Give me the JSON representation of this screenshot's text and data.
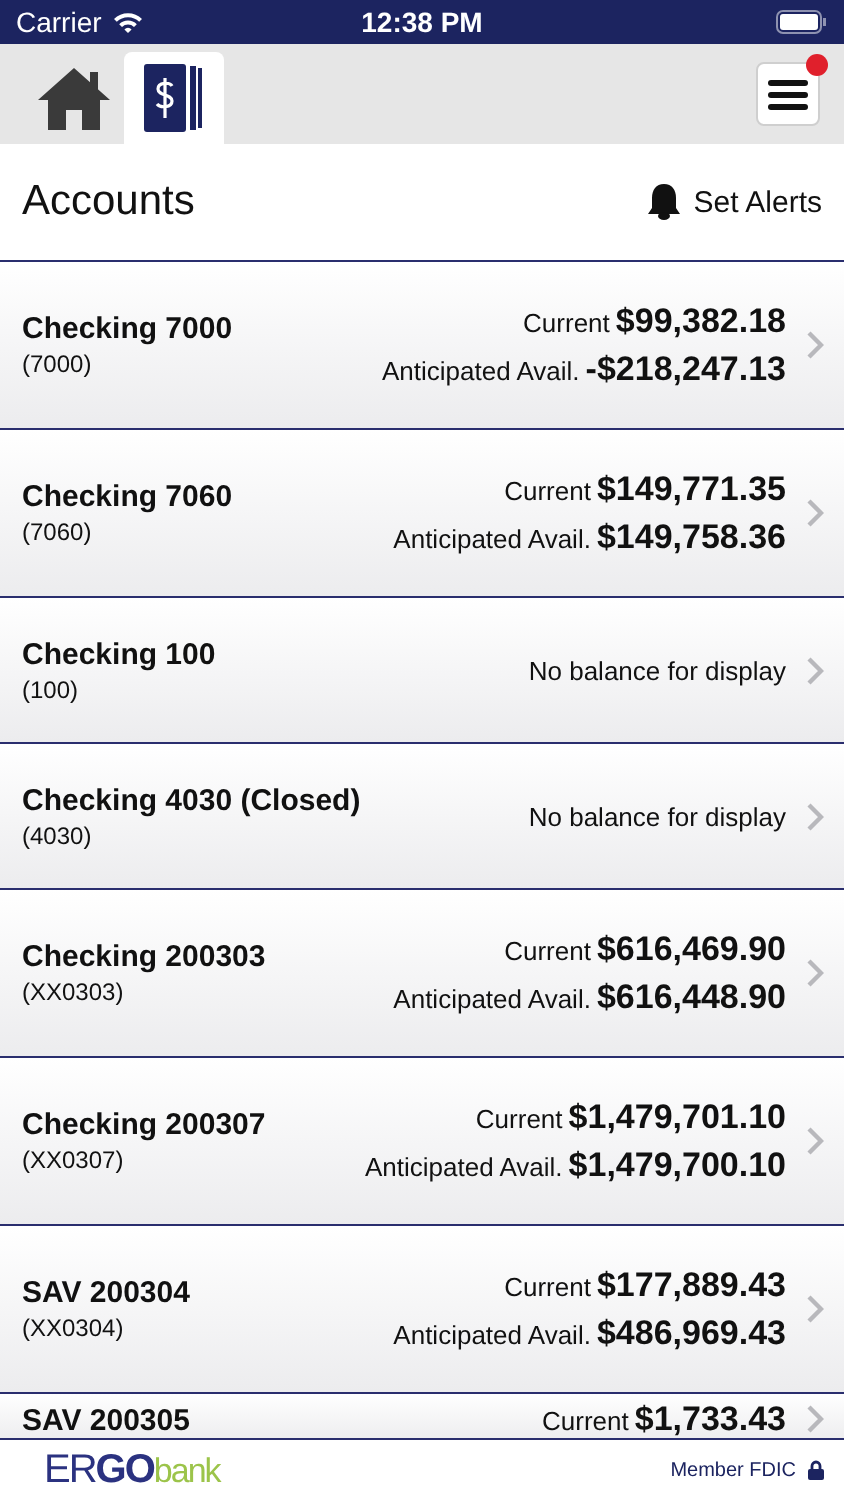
{
  "status_bar": {
    "carrier": "Carrier",
    "time": "12:38 PM"
  },
  "tabs": [
    {
      "kind": "home",
      "selected": false
    },
    {
      "kind": "accounts",
      "selected": true
    }
  ],
  "menu": {
    "notification": true
  },
  "header": {
    "title": "Accounts",
    "alerts_label": "Set Alerts"
  },
  "accounts": [
    {
      "name": "Checking 7000",
      "number": "(7000)",
      "kind": "balances",
      "current_label": "Current",
      "current": "$99,382.18",
      "avail_label": "Anticipated Avail.",
      "avail": "-$218,247.13"
    },
    {
      "name": "Checking 7060",
      "number": "(7060)",
      "kind": "balances",
      "current_label": "Current",
      "current": "$149,771.35",
      "avail_label": "Anticipated Avail.",
      "avail": "$149,758.36"
    },
    {
      "name": "Checking 100",
      "number": "(100)",
      "kind": "none",
      "message": "No balance for display"
    },
    {
      "name": "Checking 4030 (Closed)",
      "number": "(4030)",
      "kind": "none",
      "message": "No balance for display"
    },
    {
      "name": "Checking 200303",
      "number": "(XX0303)",
      "kind": "balances",
      "current_label": "Current",
      "current": "$616,469.90",
      "avail_label": "Anticipated Avail.",
      "avail": "$616,448.90"
    },
    {
      "name": "Checking 200307",
      "number": "(XX0307)",
      "kind": "balances",
      "current_label": "Current",
      "current": "$1,479,701.10",
      "avail_label": "Anticipated Avail.",
      "avail": "$1,479,700.10"
    },
    {
      "name": "SAV 200304",
      "number": "(XX0304)",
      "kind": "balances",
      "current_label": "Current",
      "current": "$177,889.43",
      "avail_label": "Anticipated Avail.",
      "avail": "$486,969.43"
    },
    {
      "name": "SAV 200305",
      "kind": "balances",
      "current_label": "Current",
      "current": "$1,733.43"
    }
  ],
  "footer": {
    "logo": [
      "ER",
      "GO",
      "bank"
    ],
    "fdic": "Member FDIC"
  }
}
